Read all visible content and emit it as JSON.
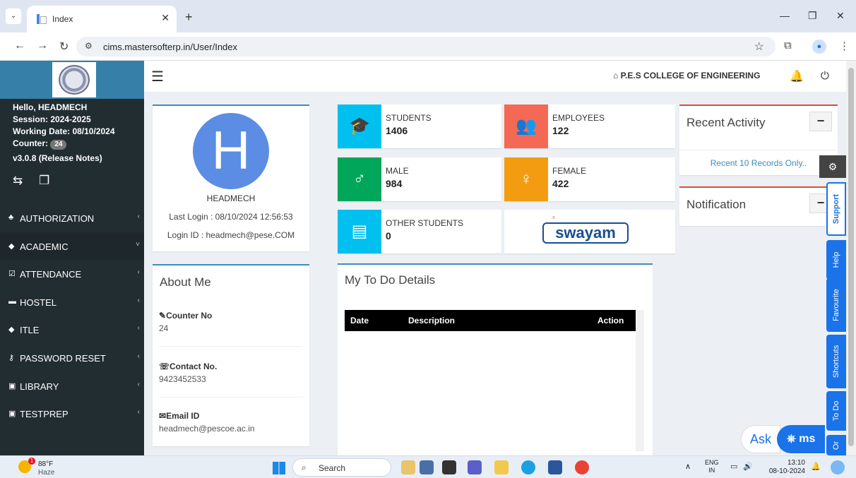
{
  "browser": {
    "tab_title": "Index",
    "url": "cims.mastersofterp.in/User/Index"
  },
  "header": {
    "college": "P.E.S COLLEGE OF ENGINEERING"
  },
  "user": {
    "hello": "Hello, HEADMECH",
    "session": "Session: 2024-2025",
    "working_date": "Working Date: 08/10/2024",
    "counter_label": "Counter:",
    "counter_value": "24",
    "version": "v3.0.8 (Release Notes)"
  },
  "menu": [
    {
      "icon": "user-plus-icon",
      "glyph": "♣",
      "label": "AUTHORIZATION",
      "chev": "‹",
      "active": false
    },
    {
      "icon": "graduation-cap-icon",
      "glyph": "◆",
      "label": "ACADEMIC",
      "chev": "˅",
      "active": true
    },
    {
      "icon": "check-square-icon",
      "glyph": "☑",
      "label": "ATTENDANCE",
      "chev": "‹",
      "active": false
    },
    {
      "icon": "bed-icon",
      "glyph": "▬",
      "label": "HOSTEL",
      "chev": "‹",
      "active": false
    },
    {
      "icon": "graduation-cap-icon",
      "glyph": "◆",
      "label": "ITLE",
      "chev": "‹",
      "active": false
    },
    {
      "icon": "key-icon",
      "glyph": "⚷",
      "label": "PASSWORD RESET",
      "chev": "‹",
      "active": false
    },
    {
      "icon": "book-icon",
      "glyph": "▣",
      "label": "LIBRARY",
      "chev": "‹",
      "active": false
    },
    {
      "icon": "book-icon",
      "glyph": "▣",
      "label": "TESTPREP",
      "chev": "‹",
      "active": false
    }
  ],
  "profile": {
    "initial": "H",
    "name": "HEADMECH",
    "last_login": "Last Login : 08/10/2024 12:56:53",
    "login_id": "Login ID : headmech@pese.COM"
  },
  "about": {
    "title": "About Me",
    "counter_label": "Counter No",
    "counter_value": "24",
    "contact_label": "Contact No.",
    "contact_value": "9423452533",
    "email_label": "Email ID",
    "email_value": "headmech@pescoe.ac.in"
  },
  "stats": {
    "students_label": "STUDENTS",
    "students_value": "1406",
    "employees_label": "EMPLOYEES",
    "employees_value": "122",
    "male_label": "MALE",
    "male_value": "984",
    "female_label": "FEMALE",
    "female_value": "422",
    "other_label": "OTHER STUDENTS",
    "other_value": "0",
    "swayam": "swayam"
  },
  "colors": {
    "students": "#00c0ef",
    "employees": "#f56954",
    "male": "#00a65a",
    "female": "#f39c12",
    "other": "#00c0ef"
  },
  "todo": {
    "title": "My To Do Details",
    "col_date": "Date",
    "col_description": "Description",
    "col_action": "Action"
  },
  "activity": {
    "title": "Recent Activity",
    "note": "Recent 10 Records Only.."
  },
  "notification": {
    "title": "Notification"
  },
  "side_tabs": [
    "Support",
    "Help",
    "Favourite",
    "Shortcuts",
    "To Do"
  ],
  "side_tab_last": "Or",
  "ask": {
    "label": "Ask",
    "bot": "ms"
  },
  "taskbar": {
    "badge": "1",
    "temp": "88°F",
    "condition": "Haze",
    "search": "Search",
    "lang1": "ENG",
    "lang2": "IN",
    "time": "13:10",
    "date": "08-10-2024"
  }
}
